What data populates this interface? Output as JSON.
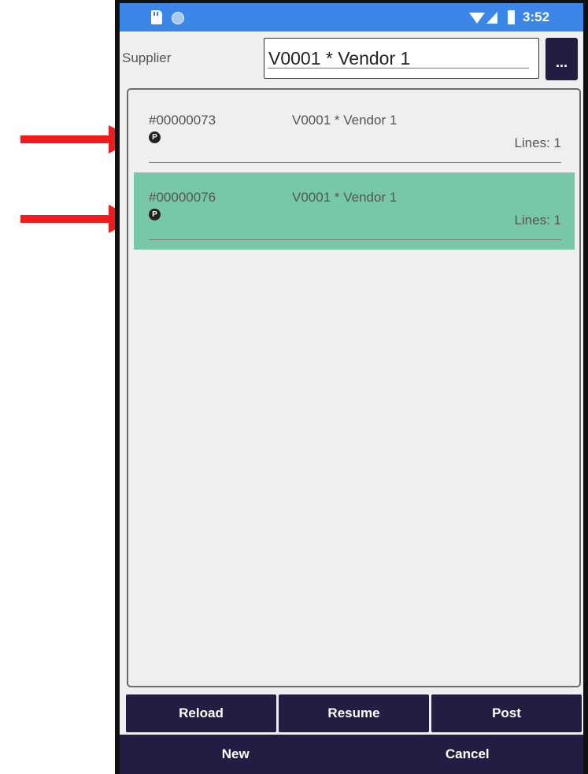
{
  "status_bar": {
    "time": "3:52",
    "icons": [
      "sd-card-icon",
      "notification-dot-icon",
      "wifi-icon",
      "signal-icon",
      "battery-icon"
    ]
  },
  "supplier": {
    "label": "Supplier",
    "value": "V0001 * Vendor 1",
    "browse_label": "..."
  },
  "documents": [
    {
      "number": "#00000073",
      "vendor": "V0001 * Vendor 1",
      "status_icon_letter": "P",
      "lines": "Lines: 1",
      "selected": false
    },
    {
      "number": "#00000076",
      "vendor": "V0001 * Vendor 1",
      "status_icon_letter": "P",
      "lines": "Lines: 1",
      "selected": true
    }
  ],
  "actions": {
    "reload": "Reload",
    "resume": "Resume",
    "post": "Post"
  },
  "nav": {
    "new": "New",
    "cancel": "Cancel"
  },
  "colors": {
    "status_bar": "#3b86e6",
    "button_bg": "#231d43",
    "selected_row": "#76c8a9",
    "annotation_arrow": "#ee1c1c"
  }
}
